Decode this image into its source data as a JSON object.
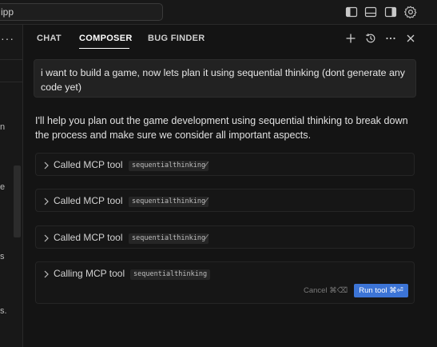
{
  "search": {
    "value": "ipp"
  },
  "left_panel": {
    "menu_label": "···",
    "fragments": [
      "n",
      "e",
      "s",
      "s."
    ]
  },
  "composer": {
    "tabs": [
      {
        "label": "CHAT"
      },
      {
        "label": "COMPOSER"
      },
      {
        "label": "BUG FINDER"
      }
    ],
    "header_icons": [
      "plus-icon",
      "history-icon",
      "more-icon",
      "close-icon"
    ],
    "user_message": "i want to build a game, now lets plan it using sequential thinking (dont generate any code yet)",
    "assistant_message": "I'll help you plan out the game development using sequential thinking to break down the process and make sure we consider all important aspects.",
    "tool_calls": [
      {
        "label": "Called MCP tool",
        "tool": "sequentialthinking",
        "status": "✓"
      },
      {
        "label": "Called MCP tool",
        "tool": "sequentialthinking",
        "status": "✓"
      },
      {
        "label": "Called MCP tool",
        "tool": "sequentialthinking",
        "status": "✓"
      },
      {
        "label": "Calling MCP tool",
        "tool": "sequentialthinking"
      }
    ],
    "cancel_label": "Cancel ⌘⌫",
    "run_label": "Run tool ⌘⏎"
  },
  "colors": {
    "background": "#141414",
    "accent": "#3c74d6"
  }
}
